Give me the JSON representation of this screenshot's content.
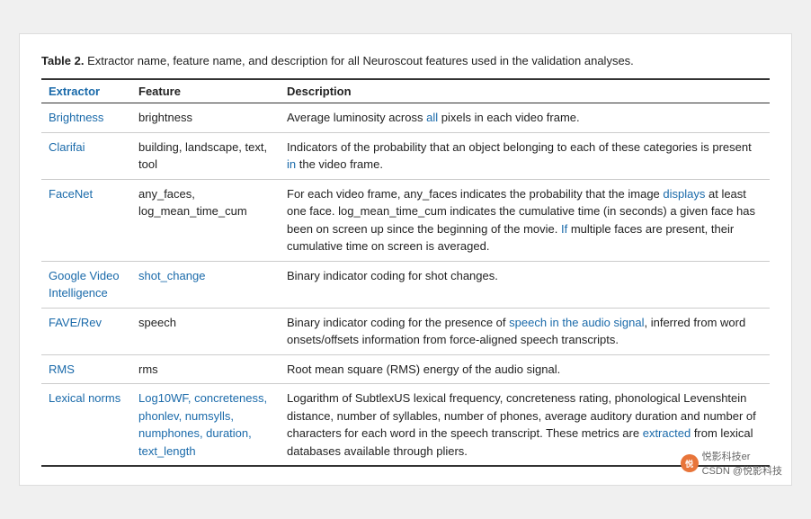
{
  "caption": {
    "bold": "Table 2.",
    "text": " Extractor name, feature name, and description for all Neuroscout features used in the validation analyses."
  },
  "table": {
    "headers": [
      "Extractor",
      "Feature",
      "Description"
    ],
    "rows": [
      {
        "extractor": "Brightness",
        "feature": "brightness",
        "description": "Average luminosity across all pixels in each video frame."
      },
      {
        "extractor": "Clarifai",
        "feature": "building, landscape, text, tool",
        "description": "Indicators of the probability that an object belonging to each of these categories is present in the video frame."
      },
      {
        "extractor": "FaceNet",
        "feature": "any_faces, log_mean_time_cum",
        "description": "For each video frame, any_faces indicates the probability that the image displays at least one face. log_mean_time_cum indicates the cumulative time (in seconds) a given face has been on screen up since the beginning of the movie. If multiple faces are present, their cumulative time on screen is averaged."
      },
      {
        "extractor": "Google Video Intelligence",
        "feature": "shot_change",
        "description": "Binary indicator coding for shot changes."
      },
      {
        "extractor": "FAVE/Rev",
        "feature": "speech",
        "description": "Binary indicator coding for the presence of speech in the audio signal, inferred from word onsets/offsets information from force-aligned speech transcripts."
      },
      {
        "extractor": "RMS",
        "feature": "rms",
        "description": "Root mean square (RMS) energy of the audio signal."
      },
      {
        "extractor": "Lexical norms",
        "feature": "Log10WF, concreteness, phonlev, numsylls, numphones, duration, text_length",
        "description": "Logarithm of SubtlexUS lexical frequency, concreteness rating, phonological Levenshtein distance, number of syllables, number of phones, average auditory duration and number of characters for each word in the speech transcript. These metrics are extracted from lexical databases available through pliers."
      }
    ]
  },
  "watermark": {
    "text": "悦影科技er",
    "subtext": "CSDN @悦影科技"
  }
}
